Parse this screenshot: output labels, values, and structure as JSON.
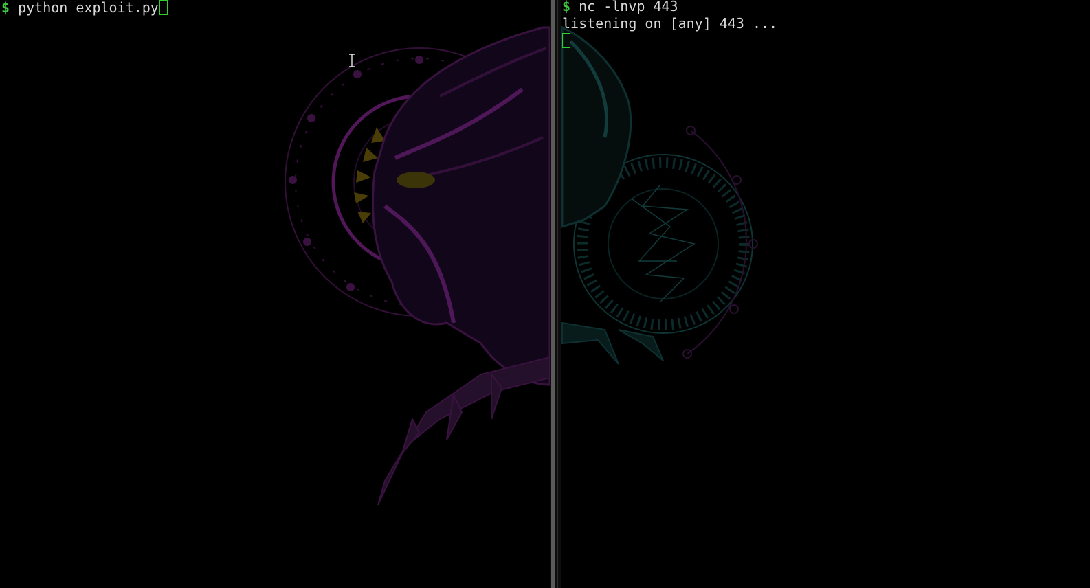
{
  "left_pane": {
    "prompt": "$",
    "command": "python exploit.py"
  },
  "right_pane": {
    "prompt": "$",
    "command": "nc -lnvp 443",
    "output": "listening on [any] 443 ..."
  },
  "colors": {
    "background": "#000000",
    "prompt": "#3fc93f",
    "text": "#d8d8d8",
    "cursor": "#2fd02f",
    "wallpaper_purple": "#6a1e7a",
    "wallpaper_teal": "#134a4a",
    "wallpaper_gold": "#7a6a10"
  },
  "icons": {
    "cursor": "text-ibeam-icon",
    "wallpaper": "panther-wallpaper"
  }
}
